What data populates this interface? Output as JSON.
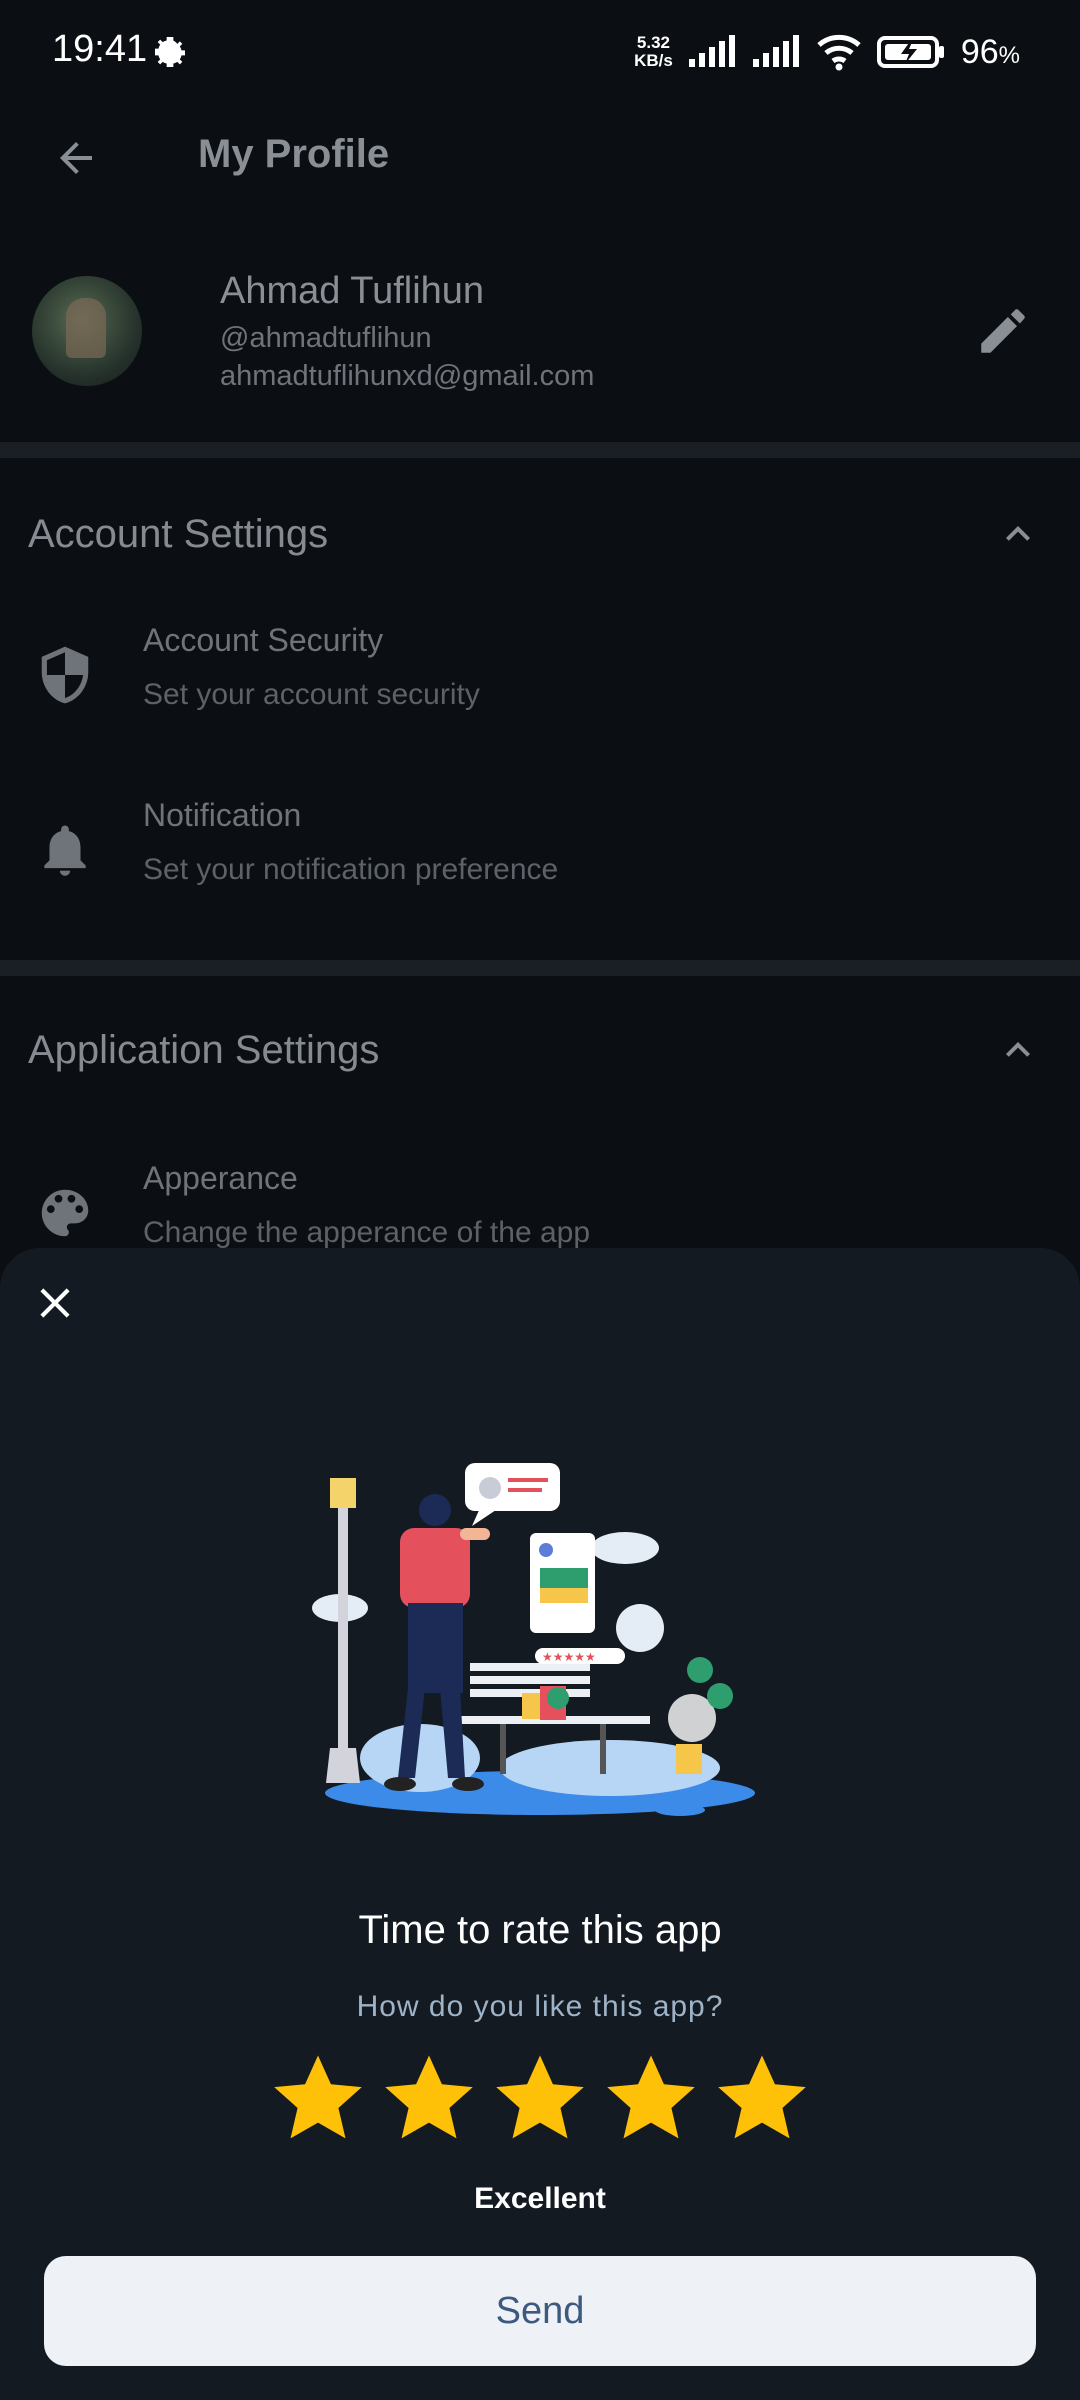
{
  "status_bar": {
    "time": "19:41",
    "speed_value": "5.32",
    "speed_unit": "KB/s",
    "battery_percent": "96",
    "battery_unit": "%"
  },
  "app_bar": {
    "title": "My Profile"
  },
  "profile": {
    "name": "Ahmad Tuflihun",
    "username": "@ahmadtuflihun",
    "email": "ahmadtuflihunxd@gmail.com"
  },
  "account_settings": {
    "title": "Account Settings",
    "items": [
      {
        "title": "Account Security",
        "subtitle": "Set your account security",
        "icon": "shield-icon"
      },
      {
        "title": "Notification",
        "subtitle": "Set your notification preference",
        "icon": "bell-icon"
      }
    ]
  },
  "application_settings": {
    "title": "Application Settings",
    "items": [
      {
        "title": "Apperance",
        "subtitle": "Change the apperance of the app",
        "icon": "palette-icon"
      }
    ]
  },
  "rating_sheet": {
    "title": "Time to rate this app",
    "subtitle": "How do you like this app?",
    "stars_selected": 5,
    "stars_total": 5,
    "rating_label": "Excellent",
    "send_label": "Send",
    "star_color": "#FFC107"
  }
}
